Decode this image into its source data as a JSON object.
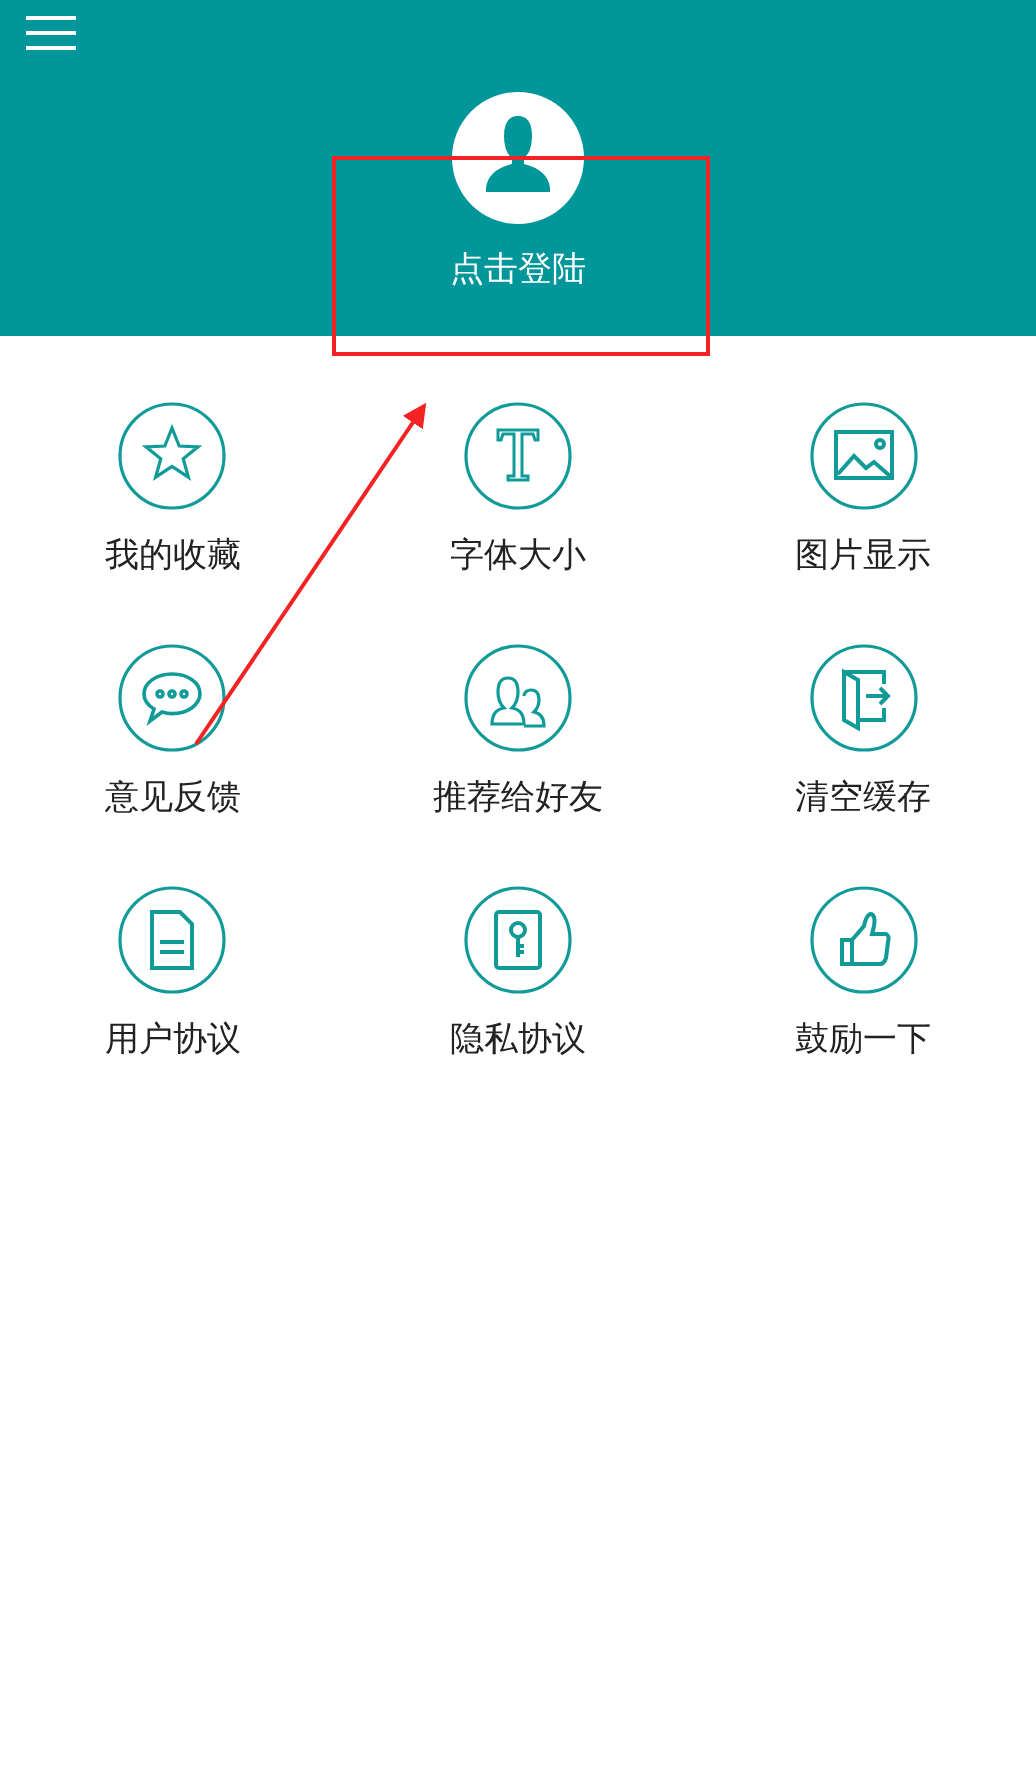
{
  "header": {
    "login_label": "点击登陆"
  },
  "menu_items": [
    {
      "label": "我的收藏"
    },
    {
      "label": "字体大小"
    },
    {
      "label": "图片显示"
    },
    {
      "label": "意见反馈"
    },
    {
      "label": "推荐给好友"
    },
    {
      "label": "清空缓存"
    },
    {
      "label": "用户协议"
    },
    {
      "label": "隐私协议"
    },
    {
      "label": "鼓励一下"
    }
  ],
  "annotations": [
    {
      "kind": "rectangle"
    },
    {
      "kind": "arrow"
    }
  ]
}
